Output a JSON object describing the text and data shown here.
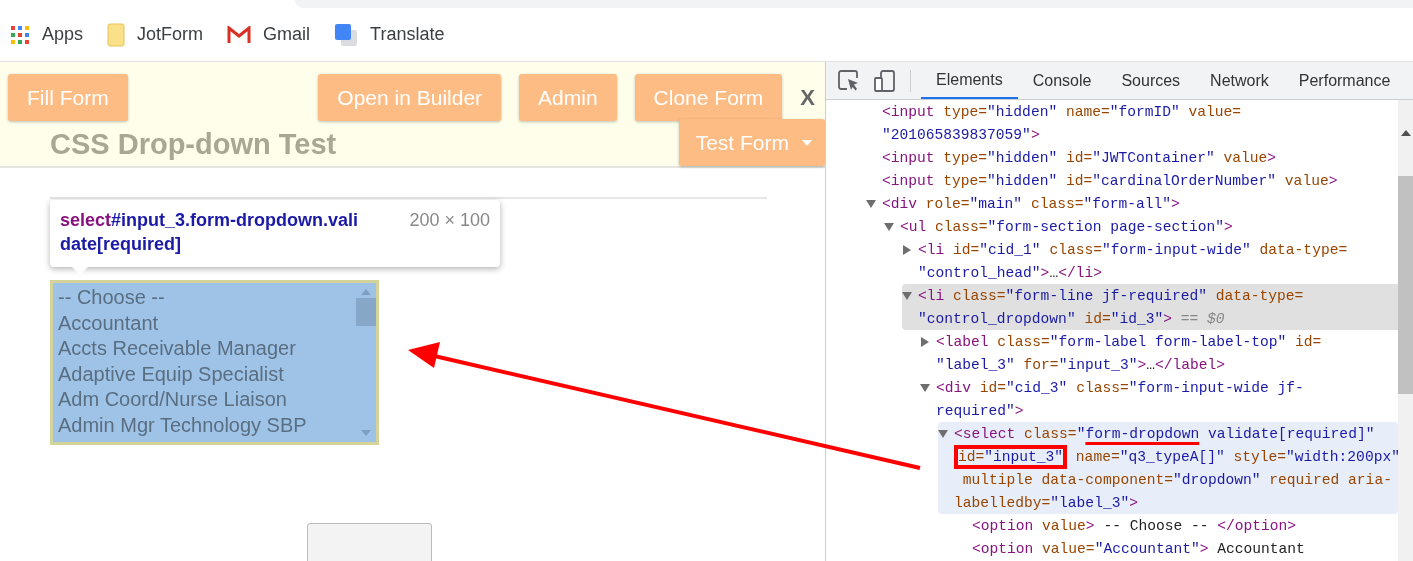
{
  "bookmarks": [
    {
      "label": "Apps"
    },
    {
      "label": "JotForm"
    },
    {
      "label": "Gmail"
    },
    {
      "label": "Translate"
    }
  ],
  "form_page": {
    "buttons": [
      "Fill Form",
      "Open in Builder",
      "Admin",
      "Clone Form"
    ],
    "close": "X",
    "test_button": "Test Form",
    "title": "CSS Drop-down Test",
    "tooltip": {
      "tag": "select",
      "selector": "#input_3.form-dropdown.validate[required]",
      "size": "200 × 100"
    },
    "listbox": {
      "options": [
        {
          "label": "-- Choose --",
          "selected": false
        },
        {
          "label": "Accountant",
          "selected": false
        },
        {
          "label": "Accts Receivable Manager",
          "selected": false
        },
        {
          "label": "Adaptive Equip Specialist",
          "selected": false
        },
        {
          "label": "Adm Coord/Nurse Liaison",
          "selected": false
        },
        {
          "label": "Admin Mgr Technology SBP",
          "selected": false
        }
      ]
    }
  },
  "devtools": {
    "tabs": [
      {
        "label": "Elements",
        "selected": true
      },
      {
        "label": "Console",
        "selected": false
      },
      {
        "label": "Sources",
        "selected": false
      },
      {
        "label": "Network",
        "selected": false
      },
      {
        "label": "Performance",
        "selected": false
      }
    ],
    "nodes": [
      {
        "selected": false,
        "hovered": false,
        "lines": [
          [
            {
              "kind": "tag",
              "t": "<input"
            },
            {
              "kind": "attr",
              "t": " type="
            },
            {
              "kind": "val",
              "t": "\"hidden\""
            },
            {
              "kind": "attr",
              "t": " name="
            },
            {
              "kind": "val",
              "t": "\"formID\""
            },
            {
              "kind": "attr",
              "t": " value="
            }
          ],
          [
            {
              "kind": "val",
              "t": "\"201065839837059\""
            },
            {
              "kind": "tag",
              "t": ">"
            }
          ]
        ]
      },
      {
        "selected": false,
        "hovered": false,
        "lines": [
          [
            {
              "kind": "tag",
              "t": "<input"
            },
            {
              "kind": "attr",
              "t": " type="
            },
            {
              "kind": "val",
              "t": "\"hidden\""
            },
            {
              "kind": "attr",
              "t": " id="
            },
            {
              "kind": "val",
              "t": "\"JWTContainer\""
            },
            {
              "kind": "attr",
              "t": " value"
            },
            {
              "kind": "tag",
              "t": ">"
            }
          ]
        ]
      },
      {
        "selected": false,
        "hovered": false,
        "lines": [
          [
            {
              "kind": "tag",
              "t": "<input"
            },
            {
              "kind": "attr",
              "t": " type="
            },
            {
              "kind": "val",
              "t": "\"hidden\""
            },
            {
              "kind": "attr",
              "t": " id="
            },
            {
              "kind": "val",
              "t": "\"cardinalOrderNumber\""
            },
            {
              "kind": "attr",
              "t": " value"
            },
            {
              "kind": "tag",
              "t": ">"
            }
          ]
        ]
      },
      {
        "expanded": true,
        "selected": false,
        "hovered": false,
        "lines": [
          [
            {
              "kind": "tag",
              "t": "<div"
            },
            {
              "kind": "attr",
              "t": " role="
            },
            {
              "kind": "val",
              "t": "\"main\""
            },
            {
              "kind": "attr",
              "t": " class="
            },
            {
              "kind": "val",
              "t": "\"form-all\""
            },
            {
              "kind": "tag",
              "t": ">"
            }
          ]
        ],
        "children": [
          {
            "expanded": true,
            "selected": false,
            "hovered": false,
            "lines": [
              [
                {
                  "kind": "tag",
                  "t": "<ul"
                },
                {
                  "kind": "attr",
                  "t": " class="
                },
                {
                  "kind": "val",
                  "t": "\"form-section page-section\""
                },
                {
                  "kind": "tag",
                  "t": ">"
                }
              ]
            ],
            "children": [
              {
                "expanded": false,
                "selected": false,
                "hovered": false,
                "lines": [
                  [
                    {
                      "kind": "tag",
                      "t": "<li"
                    },
                    {
                      "kind": "attr",
                      "t": " id="
                    },
                    {
                      "kind": "val",
                      "t": "\"cid_1\""
                    },
                    {
                      "kind": "attr",
                      "t": " class="
                    },
                    {
                      "kind": "val",
                      "t": "\"form-input-wide\""
                    },
                    {
                      "kind": "attr",
                      "t": " data-type="
                    }
                  ],
                  [
                    {
                      "kind": "val",
                      "t": "\"control_head\""
                    },
                    {
                      "kind": "tag",
                      "t": ">"
                    },
                    {
                      "kind": "text",
                      "t": "…"
                    },
                    {
                      "kind": "tag",
                      "t": "</li>"
                    }
                  ]
                ]
              },
              {
                "expanded": true,
                "selected": true,
                "hovered": false,
                "lines": [
                  [
                    {
                      "kind": "tag",
                      "t": "<li"
                    },
                    {
                      "kind": "attr",
                      "t": " class="
                    },
                    {
                      "kind": "val",
                      "t": "\"form-line jf-required\""
                    },
                    {
                      "kind": "attr",
                      "t": " data-type="
                    }
                  ],
                  [
                    {
                      "kind": "val",
                      "t": "\"control_dropdown\""
                    },
                    {
                      "kind": "attr",
                      "t": " id="
                    },
                    {
                      "kind": "val",
                      "t": "\"id_3\""
                    },
                    {
                      "kind": "tag",
                      "t": ">"
                    },
                    {
                      "kind": "note",
                      "t": " == $0"
                    }
                  ]
                ],
                "children": [
                  {
                    "expanded": false,
                    "selected": false,
                    "hovered": false,
                    "lines": [
                      [
                        {
                          "kind": "tag",
                          "t": "<label"
                        },
                        {
                          "kind": "attr",
                          "t": " class="
                        },
                        {
                          "kind": "val",
                          "t": "\"form-label form-label-top\""
                        },
                        {
                          "kind": "attr",
                          "t": " id="
                        }
                      ],
                      [
                        {
                          "kind": "val",
                          "t": "\"label_3\""
                        },
                        {
                          "kind": "attr",
                          "t": " for="
                        },
                        {
                          "kind": "val",
                          "t": "\"input_3\""
                        },
                        {
                          "kind": "tag",
                          "t": ">"
                        },
                        {
                          "kind": "text",
                          "t": "…"
                        },
                        {
                          "kind": "tag",
                          "t": "</label>"
                        }
                      ]
                    ]
                  },
                  {
                    "expanded": true,
                    "selected": false,
                    "hovered": false,
                    "lines": [
                      [
                        {
                          "kind": "tag",
                          "t": "<div"
                        },
                        {
                          "kind": "attr",
                          "t": " id="
                        },
                        {
                          "kind": "val",
                          "t": "\"cid_3\""
                        },
                        {
                          "kind": "attr",
                          "t": " class="
                        },
                        {
                          "kind": "val",
                          "t": "\"form-input-wide jf-"
                        }
                      ],
                      [
                        {
                          "kind": "val",
                          "t": "required\""
                        },
                        {
                          "kind": "tag",
                          "t": ">"
                        }
                      ]
                    ],
                    "children": [
                      {
                        "expanded": true,
                        "selected": false,
                        "hovered": true,
                        "lines": [
                          [
                            {
                              "kind": "tag",
                              "t": "<select"
                            },
                            {
                              "kind": "attr",
                              "t": " class="
                            },
                            {
                              "kind": "val",
                              "t": "\""
                            },
                            {
                              "kind": "val",
                              "t": "form-dropdown",
                              "underlined": true
                            },
                            {
                              "kind": "val",
                              "t": " validate[required]\""
                            }
                          ],
                          [
                            {
                              "boxed": true,
                              "segs": [
                                {
                                  "kind": "attr",
                                  "t": "id="
                                },
                                {
                                  "kind": "val",
                                  "t": "\"input_3\""
                                }
                              ]
                            },
                            {
                              "kind": "attr",
                              "t": " name="
                            },
                            {
                              "kind": "val",
                              "t": "\"q3_typeA[]\""
                            },
                            {
                              "kind": "attr",
                              "t": " style="
                            },
                            {
                              "kind": "val",
                              "t": "\"width:200px\""
                            }
                          ],
                          [
                            {
                              "kind": "attr",
                              "t": " multiple data-component="
                            },
                            {
                              "kind": "val",
                              "t": "\"dropdown\""
                            },
                            {
                              "kind": "attr",
                              "t": " required aria-"
                            }
                          ],
                          [
                            {
                              "kind": "attr",
                              "t": "labelledby="
                            },
                            {
                              "kind": "val",
                              "t": "\"label_3\""
                            },
                            {
                              "kind": "tag",
                              "t": ">"
                            }
                          ]
                        ],
                        "children": [
                          {
                            "selected": false,
                            "hovered": false,
                            "lines": [
                              [
                                {
                                  "kind": "tag",
                                  "t": "<option"
                                },
                                {
                                  "kind": "attr",
                                  "t": " value"
                                },
                                {
                                  "kind": "tag",
                                  "t": ">"
                                },
                                {
                                  "kind": "text",
                                  "t": " -- Choose -- "
                                },
                                {
                                  "kind": "tag",
                                  "t": "</option>"
                                }
                              ]
                            ]
                          },
                          {
                            "selected": false,
                            "hovered": false,
                            "lines": [
                              [
                                {
                                  "kind": "tag",
                                  "t": "<option"
                                },
                                {
                                  "kind": "attr",
                                  "t": " value="
                                },
                                {
                                  "kind": "val",
                                  "t": "\"Accountant\""
                                },
                                {
                                  "kind": "tag",
                                  "t": ">"
                                },
                                {
                                  "kind": "text",
                                  "t": " Accountant"
                                }
                              ]
                            ]
                          }
                        ]
                      }
                    ]
                  }
                ]
              }
            ]
          }
        ]
      }
    ]
  }
}
